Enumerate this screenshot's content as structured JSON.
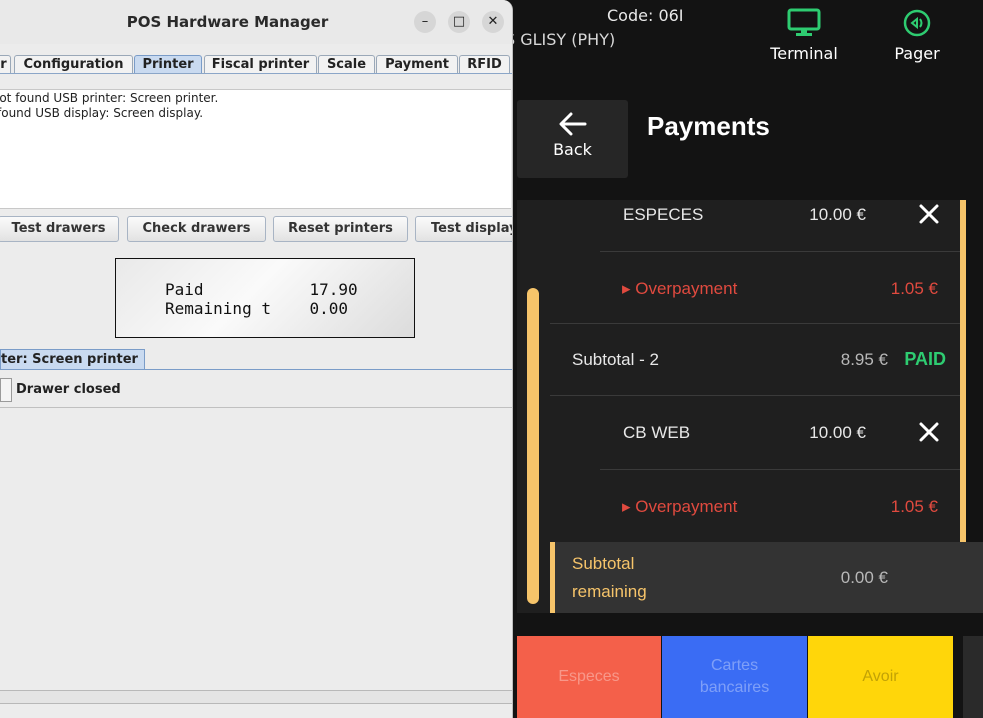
{
  "pos": {
    "code_label": "Code:  06I",
    "store_text": "S GLISY (PHY)",
    "terminal_label": "Terminal",
    "pager_label": "Pager",
    "back_label": "Back",
    "title": "Payments",
    "payments": [
      {
        "method": "ESPECES",
        "amount": "10.00 €",
        "overpayment_label": "▸ Overpayment",
        "overpayment_amount": "1.05 €"
      },
      {
        "method": "CB WEB",
        "amount": "10.00 €",
        "overpayment_label": "▸ Overpayment",
        "overpayment_amount": "1.05 €"
      }
    ],
    "subtotal_2": {
      "label": "Subtotal - 2",
      "amount": "8.95 €",
      "status": "PAID"
    },
    "subtotal_remaining": {
      "label_line1": "Subtotal",
      "label_line2": "remaining",
      "amount": "0.00 €"
    },
    "pay_buttons": {
      "especes": "Especes",
      "cartes_line1": "Cartes",
      "cartes_line2": "bancaires",
      "avoir": "Avoir"
    },
    "colors": {
      "accent": "#f6c46a",
      "paid": "#2ecc71",
      "overpay": "#e04a3f",
      "terminal_icon": "#2ecc71"
    }
  },
  "hw": {
    "title": "POS Hardware Manager",
    "win_controls": {
      "minimize": "–",
      "maximize": "□",
      "close": "✕"
    },
    "tabs": [
      "r",
      "Configuration",
      "Printer",
      "Fiscal printer",
      "Scale",
      "Payment",
      "RFID"
    ],
    "active_tab": "Printer",
    "log_lines": [
      "lot found USB printer: Screen printer.",
      " found USB display: Screen display."
    ],
    "buttons": [
      "Test drawers",
      "Check drawers",
      "Reset printers",
      "Test display"
    ],
    "display_line1": "Paid           17.90",
    "display_line2": "Remaining t    0.00",
    "subtab": "ter: Screen printer",
    "drawer_status": "Drawer closed"
  }
}
